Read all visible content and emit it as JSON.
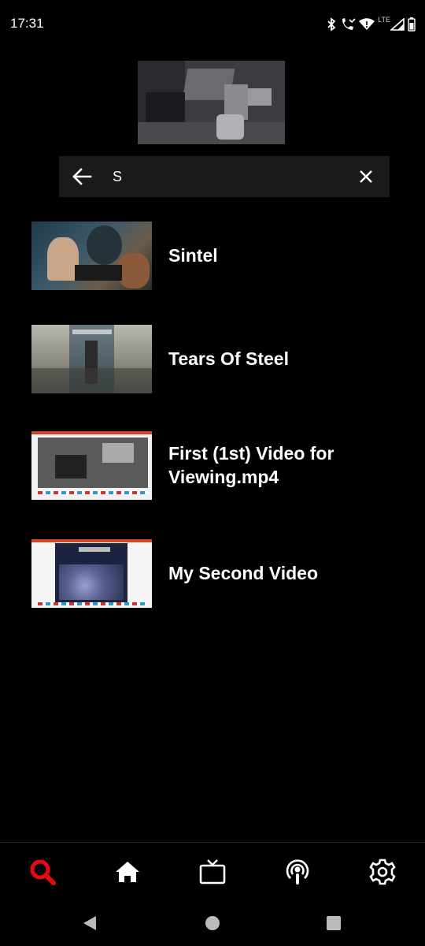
{
  "status_bar": {
    "time": "17:31",
    "network_label": "LTE",
    "icons": [
      "bluetooth-icon",
      "wifi-calling-icon",
      "wifi-icon",
      "signal-icon",
      "battery-icon"
    ]
  },
  "search": {
    "query": "S",
    "back_icon": "arrow-left-icon",
    "clear_icon": "close-icon"
  },
  "results": [
    {
      "title": "Sintel"
    },
    {
      "title": "Tears Of Steel"
    },
    {
      "title": "First (1st) Video for Viewing.mp4"
    },
    {
      "title": "My Second Video"
    }
  ],
  "bottom_nav": {
    "items": [
      {
        "icon": "search-icon",
        "active": true
      },
      {
        "icon": "home-icon",
        "active": false
      },
      {
        "icon": "tv-icon",
        "active": false
      },
      {
        "icon": "podcast-icon",
        "active": false
      },
      {
        "icon": "gear-icon",
        "active": false
      }
    ]
  },
  "colors": {
    "background": "#000000",
    "accent": "#e50914",
    "text": "#ffffff",
    "search_field": "#1a1a1a"
  },
  "system_nav": {
    "icons": [
      "back-triangle-icon",
      "home-circle-icon",
      "recents-square-icon"
    ]
  }
}
